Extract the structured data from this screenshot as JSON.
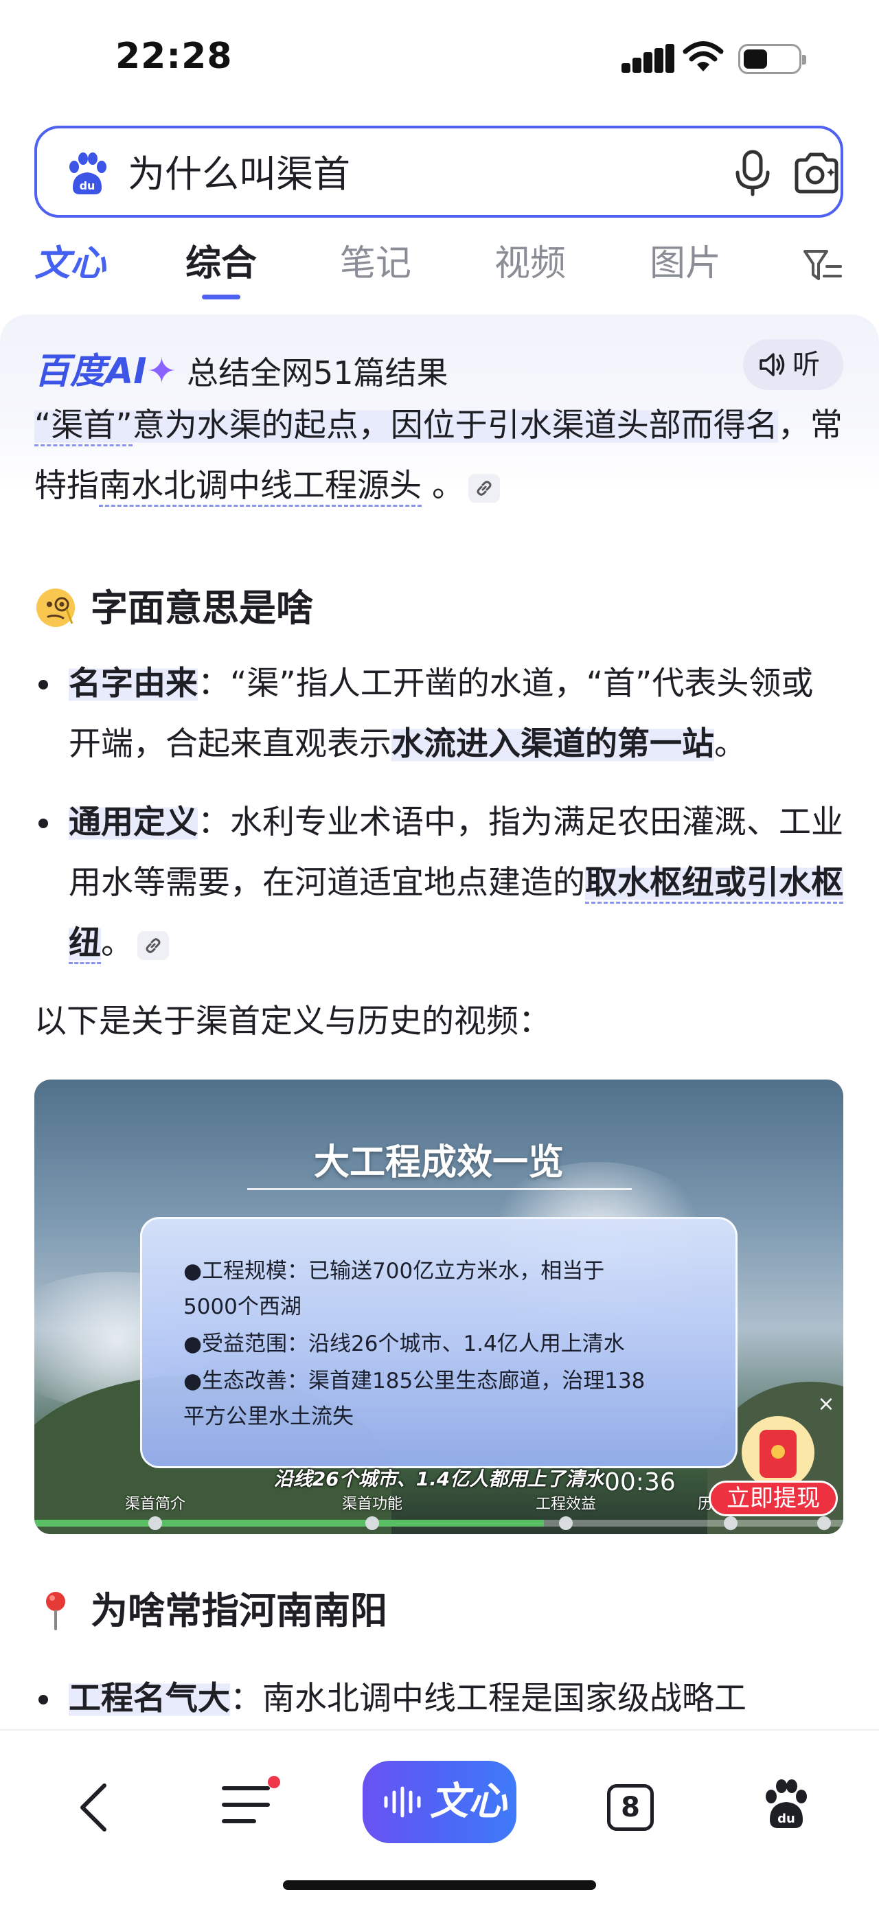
{
  "status": {
    "time": "22:28"
  },
  "search": {
    "query": "为什么叫渠首"
  },
  "tabs": {
    "wenxin": "文心",
    "items": [
      "综合",
      "笔记",
      "视频",
      "图片"
    ]
  },
  "ai": {
    "logo": "百度AI",
    "summary": "总结全网51篇结果",
    "listen": "听",
    "intro": {
      "t1": "“渠首”",
      "t2": "意为水渠的起点，因位于引水渠道头部而得",
      "t3": "名",
      "t4": "，常特指",
      "t5": "南水北调中线工程源头",
      "t6": " 。"
    },
    "section1": {
      "title": "字面意思是啥",
      "b1": {
        "term": "名字由来",
        "p1": "：“渠”指人工开凿的水道，“首”代表头领或开端，合起来直观表示",
        "strong": "水流进入渠道的第一站",
        "p2": "。"
      },
      "b2": {
        "term": "通用定义",
        "p1": "：水利专业术语中，指为满足农田灌溉、工业用水等需要，在河道适宜地点建造的",
        "strong": "取水枢纽或引水枢纽",
        "p2": "。"
      }
    },
    "video_intro": "以下是关于渠首定义与历史的视频："
  },
  "video": {
    "title": "大工程成效一览",
    "lines": [
      "●工程规模：已输送700亿立方米水，相当于",
      "5000个西湖",
      "●受益范围：沿线26个城市、1.4亿人用上清水",
      "●生态改善：渠首建185公里生态廊道，治理138",
      "平方公里水土流失"
    ],
    "subtitle": "沿线26个城市、1.4亿人都用上了清水",
    "time": "00:36",
    "chapters": [
      "渠首简介",
      "渠首功能",
      "工程效益",
      "历"
    ],
    "progress": 0.63,
    "close": "×",
    "cash_button": "立即提现"
  },
  "section2": {
    "title": "为啥常指河南南阳",
    "b1": {
      "term": "工程名气大",
      "p1": "：南水北调中线工程是国家级战略工"
    }
  },
  "bottom": {
    "wenxin": "文心",
    "tab_count": "8"
  }
}
